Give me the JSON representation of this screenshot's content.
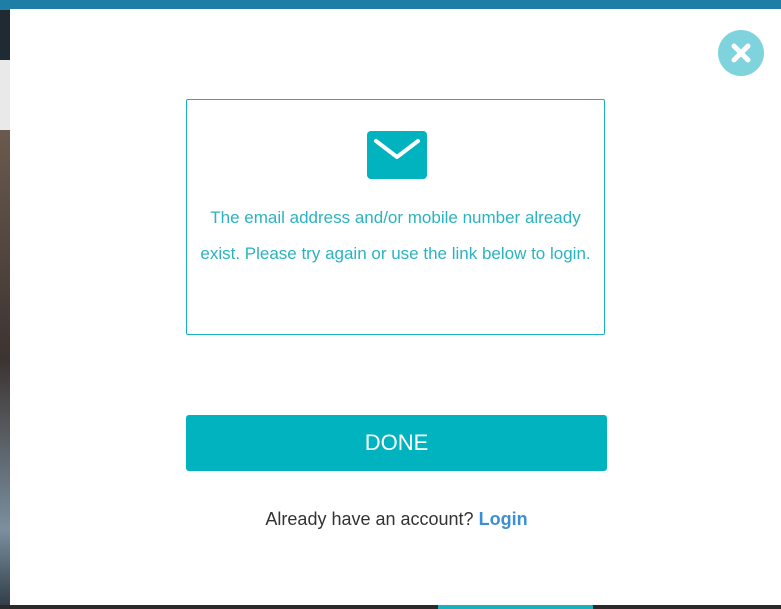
{
  "modal": {
    "close_icon": "close-icon",
    "mail_icon": "envelope-icon",
    "message": "The email address and/or mobile number already exist. Please try again or use the link below to login.",
    "done_label": "DONE",
    "login_prompt": "Already have an account?",
    "login_link_label": "Login"
  },
  "colors": {
    "accent": "#00b3bf",
    "close_button": "#7ed3dc",
    "message_text": "#2ab3c0",
    "link": "#3b8fd6",
    "top_bar": "#1f7ea6"
  }
}
